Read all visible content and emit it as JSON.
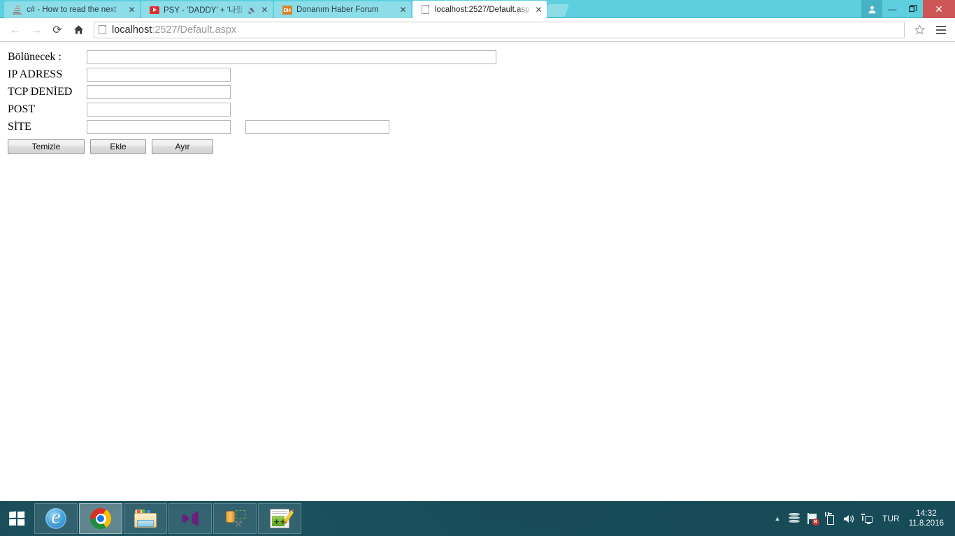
{
  "window": {
    "controls": {
      "profile_icon": "user-icon",
      "minimize_label": "—",
      "maximize_label": "❐",
      "close_label": "✕"
    }
  },
  "tabs": [
    {
      "title": "c# - How to read the next",
      "favicon": "stackoverflow-icon",
      "close_label": "✕",
      "active": false,
      "audio": false
    },
    {
      "title": "PSY - 'DADDY' + '나팔",
      "favicon": "youtube-icon",
      "close_label": "✕",
      "active": false,
      "audio": true,
      "audio_glyph": "🔊"
    },
    {
      "title": "Donanım Haber Forum",
      "favicon": "dh-icon",
      "favicon_text": "DH",
      "close_label": "✕",
      "active": false,
      "audio": false
    },
    {
      "title": "localhost:2527/Default.asp",
      "favicon": "page-icon",
      "close_label": "✕",
      "active": true,
      "audio": false
    }
  ],
  "toolbar": {
    "back_glyph": "←",
    "forward_glyph": "→",
    "reload_glyph": "⟳",
    "home_glyph": "⌂",
    "bookmark_glyph": "☆",
    "url_host": "localhost",
    "url_rest": ":2527/Default.aspx"
  },
  "page": {
    "rows": [
      {
        "label": "Bölünecek :",
        "value": "",
        "placeholder": "",
        "width": "long"
      },
      {
        "label": "IP ADRESS",
        "value": "",
        "placeholder": "",
        "width": "std"
      },
      {
        "label": "TCP DENİED",
        "value": "",
        "placeholder": "",
        "width": "std"
      },
      {
        "label": "POST",
        "value": "",
        "placeholder": "",
        "width": "std"
      },
      {
        "label": "SİTE",
        "value": "",
        "placeholder": "",
        "width": "std",
        "second_value": "",
        "second_placeholder": ""
      }
    ],
    "buttons": {
      "clear": "Temizle",
      "add": "Ekle",
      "split": "Ayır"
    }
  },
  "taskbar": {
    "start_name": "windows-start",
    "items": [
      {
        "name": "internet-explorer",
        "state": "pinned"
      },
      {
        "name": "google-chrome",
        "state": "active"
      },
      {
        "name": "file-explorer",
        "state": "open"
      },
      {
        "name": "visual-studio",
        "state": "open",
        "glyph": "∞"
      },
      {
        "name": "sql-tools",
        "state": "open"
      },
      {
        "name": "notepad-plus-plus",
        "state": "open",
        "glyph": "++"
      }
    ],
    "tray": {
      "expand_glyph": "▲",
      "icons": [
        "stack-icon",
        "action-center-flag-icon",
        "battery-icon",
        "volume-icon",
        "network-icon"
      ],
      "volume_glyph": "🔊",
      "flag_error_glyph": "✕",
      "language": "TUR",
      "time": "14:32",
      "date": "11.8.2016"
    }
  },
  "colors": {
    "tab_strip": "#5ecfde",
    "tab_inactive": "#8ddde9",
    "tab_active": "#ffffff",
    "close_button": "#cc5555",
    "taskbar": "#164854",
    "chrome_blue": "#1a73e8"
  }
}
